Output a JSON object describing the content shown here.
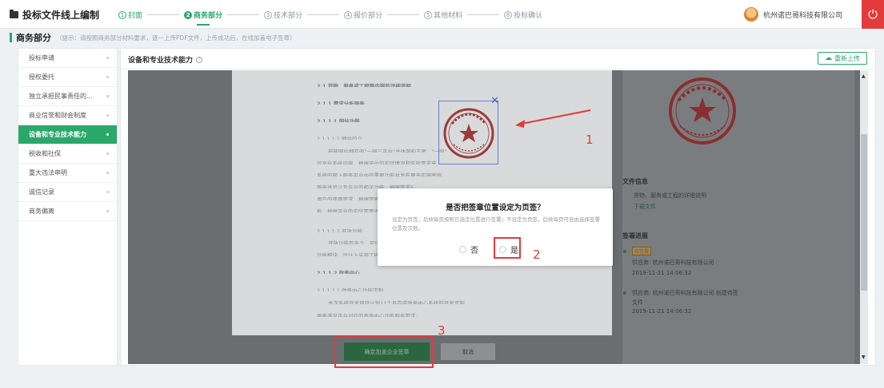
{
  "app": {
    "title": "投标文件线上编制",
    "company": "杭州诺巴哥科技有限公司"
  },
  "steps": [
    {
      "num": "1",
      "label": "封面"
    },
    {
      "num": "2",
      "label": "商务部分"
    },
    {
      "num": "3",
      "label": "技术部分"
    },
    {
      "num": "4",
      "label": "报价部分"
    },
    {
      "num": "5",
      "label": "其他材料"
    },
    {
      "num": "6",
      "label": "投标确认"
    }
  ],
  "section": {
    "title": "商务部分",
    "hint": "（提示：请按照商务部分材料要求，逐一上传PDF文件，上传成功后，在线加盖电子签章）"
  },
  "sidebar": {
    "items": [
      {
        "label": "投标申请"
      },
      {
        "label": "授权委托"
      },
      {
        "label": "独立承担民事责任的..."
      },
      {
        "label": "商业信誉和财会制度"
      },
      {
        "label": "设备和专业技术能力"
      },
      {
        "label": "税收和社保"
      },
      {
        "label": "重大违法申明"
      },
      {
        "label": "诚信记录"
      },
      {
        "label": "商务偏离"
      }
    ],
    "active_index": 4
  },
  "main": {
    "title": "设备和专业技术能力",
    "reupload_label": "重新上传"
  },
  "document": {
    "lines": [
      "2.1 货物、服务或工程等内容的详细说明",
      "2.1.1 需求分析服务",
      "2.1.1.1 网站功能",
      "2.1.1.1.1 网站的介",
      "新能网站拥有的\"一网三平台\"总体架构方案，\"一网\"",
      "信息化系统内容，根据单位的实际情况和实际需求来",
      "系统的网上服务平台中的重要功能并发布更多实施案例",
      "服务体验以及平台的相关功能，根据需求调整以实现",
      "用户的使用需求，根据需要进行更新优化和完善",
      "能，根据平台的实际需要进行网站改版与优化",
      "2.1.1.1.2 开放功能",
      "开放功能有多个，可以为用户提供更加完善的使用",
      "功能模块，设计上采用了模块化的管理方式和功能",
      "2.1.1.2 政务中心",
      "2.1.1.2.1 政务中心功能定制",
      "本次系统开发项目计划11个月完成政务中心系统的开发定制，",
      "服务满足平台对应的政务中心功能服务需求。"
    ],
    "confirm_label": "确定加盖企业签章",
    "cancel_label": "取消"
  },
  "right_pane": {
    "file_info_title": "文件信息",
    "file_name": "货物、服务或工程的详细说明",
    "download_label": "下载文件",
    "sign_progress_title": "签署进展",
    "status_tag": "待签署",
    "entries": [
      {
        "text": "供应商: 杭州诺巴哥科技有限公司",
        "time": "2019-11-21 14:06:32"
      },
      {
        "text": "供应商: 杭州诺巴哥科技有限公司 创建待签",
        "text2": "文件",
        "time": "2019-11-21 14:06:32"
      }
    ]
  },
  "modal": {
    "title": "是否把签章位置设定为页签？",
    "description": "设定为页签，后续每页按照已选定位置进行签署；不设定为页签，后续每页可自由选择签署位置及次数。",
    "option_no": "否",
    "option_yes": "是"
  },
  "annotations": {
    "n1": "1",
    "n2": "2",
    "n3": "3"
  },
  "colors": {
    "accent": "#2aa86a",
    "annotation": "#e33b3b",
    "power": "#e33b3b"
  }
}
